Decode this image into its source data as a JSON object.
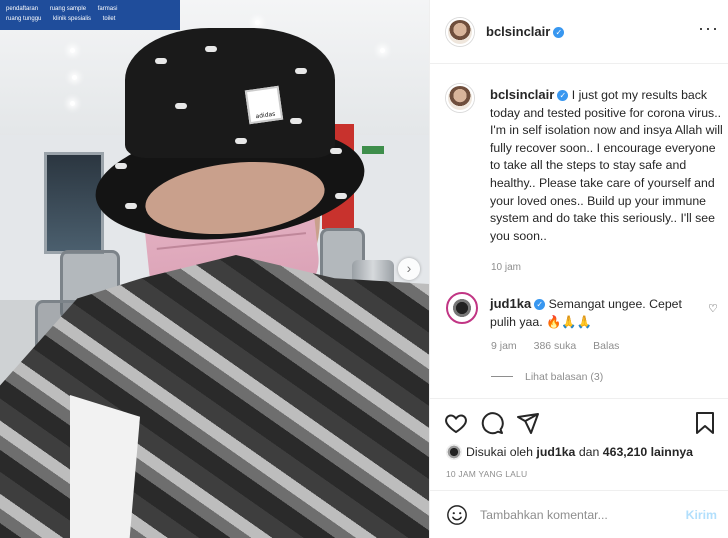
{
  "post": {
    "photo_sign_items": [
      "pendaftaran",
      "ruang tunggu",
      "ruang sample",
      "klinik spesialis",
      "farmasi",
      "toilet"
    ],
    "hat_logo_text": "adidas"
  },
  "header": {
    "username": "bclsinclair",
    "verified_mark": "✓"
  },
  "caption": {
    "username": "bclsinclair",
    "verified_mark": "✓",
    "text": "I just got my results back today and tested positive for corona virus.. I'm in self isolation now and insya Allah will fully recover soon.. I encourage everyone to take all the steps to stay safe and healthy.. Please take care of yourself and your loved ones.. Build up your immune system and do take this seriously.. I'll see you soon..",
    "time": "10 jam"
  },
  "comment": {
    "username": "jud1ka",
    "verified_mark": "✓",
    "text": "Semangat ungee. Cepet pulih yaa. 🔥🙏🙏",
    "time": "9 jam",
    "likes": "386 suka",
    "reply": "Balas",
    "view_replies": "Lihat balasan (3)"
  },
  "likes": {
    "prefix": "Disukai oleh",
    "user": "jud1ka",
    "middle": "dan",
    "count": "463,210 lainnya"
  },
  "timestamp": "10 JAM YANG LALU",
  "add_comment": {
    "placeholder": "Tambahkan komentar...",
    "post_label": "Kirim"
  },
  "colors": {
    "verified": "#3897f0",
    "post_button_disabled": "#b2dffc",
    "secondary_text": "#8e8e8e"
  },
  "icons": [
    "more-icon",
    "heart-icon",
    "comment-icon",
    "share-icon",
    "bookmark-icon",
    "emoji-icon",
    "next-arrow-icon"
  ]
}
